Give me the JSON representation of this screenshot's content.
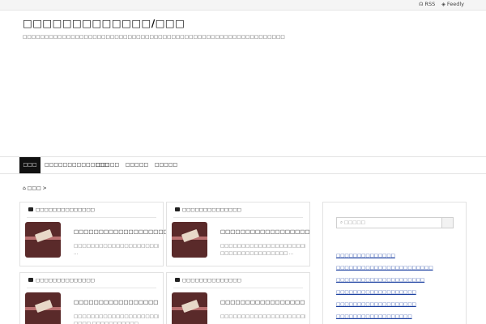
{
  "topbar": {
    "rss": "RSS",
    "feedly": "Feedly",
    "rss_icon": "rss-icon",
    "feedly_icon": "feedly-icon"
  },
  "site": {
    "title": "□□□□□□□□□□□□□/□□□",
    "description": "□□□□□□□□□□□□□□□□□□□□□□□□□□□□□□□□□□□□□□□□□□□□□□□□□□□□□□□□□□□□"
  },
  "nav": {
    "items": [
      "□□□",
      "□□□□□□□□□□□□□□",
      "□□□□□",
      "□□□□□",
      "□□□□□"
    ]
  },
  "breadcrumb": {
    "home": "□□□",
    "sep": ">"
  },
  "cards": [
    {
      "category": "□□□□□□□□□□□□□□",
      "title": "□□□□□□□□□□□□□□□□□□□",
      "excerpt": "□□□□□□□□□□□□□□□□□□□□□□□□□□□□□□□□□□□□□□□□□□□□□□□□ ..."
    },
    {
      "category": "□□□□□□□□□□□□□□",
      "title": "□□□□□□□□□□□□□□□□□□",
      "excerpt": "□□□□□□□□□□□□□□□□□□□□□□□□□□/□□□□□□□□□□□□□□□□ ..."
    },
    {
      "category": "□□□□□□□□□□□□□□",
      "title": "□□□□□□□□□□□□□□□□□",
      "excerpt": "□□□□□□□□□□□□□□□□□□□□□□□□□□/□□□□ □□□□□□□□□□□ ..."
    },
    {
      "category": "□□□□□□□□□□□□□□",
      "title": "□□□□□□□□□□□□□□□□□",
      "excerpt": "□□□□□□□□□□□□□□□□□□□□□□□□□□□□□□□□□□□□□□□□□□□□□ ..."
    }
  ],
  "sidebar": {
    "search_placeholder": "□□□□□",
    "links": [
      "□□□□□□□□□□□□□□",
      "□□□□□□□□□□□□□□□□□□□□□□□",
      "□□□□□□□□□□□□□□□□□□□□□",
      "□□□□□□□□□□□□□□□□□□□",
      "□□□□□□□□□□□□□□□□□□□",
      "□□□□□□□□□□□□□□□□□□"
    ]
  },
  "colors": {
    "nav_active_bg": "#111111",
    "link": "#1a3fa0",
    "thumb": "#5a2a2a"
  }
}
